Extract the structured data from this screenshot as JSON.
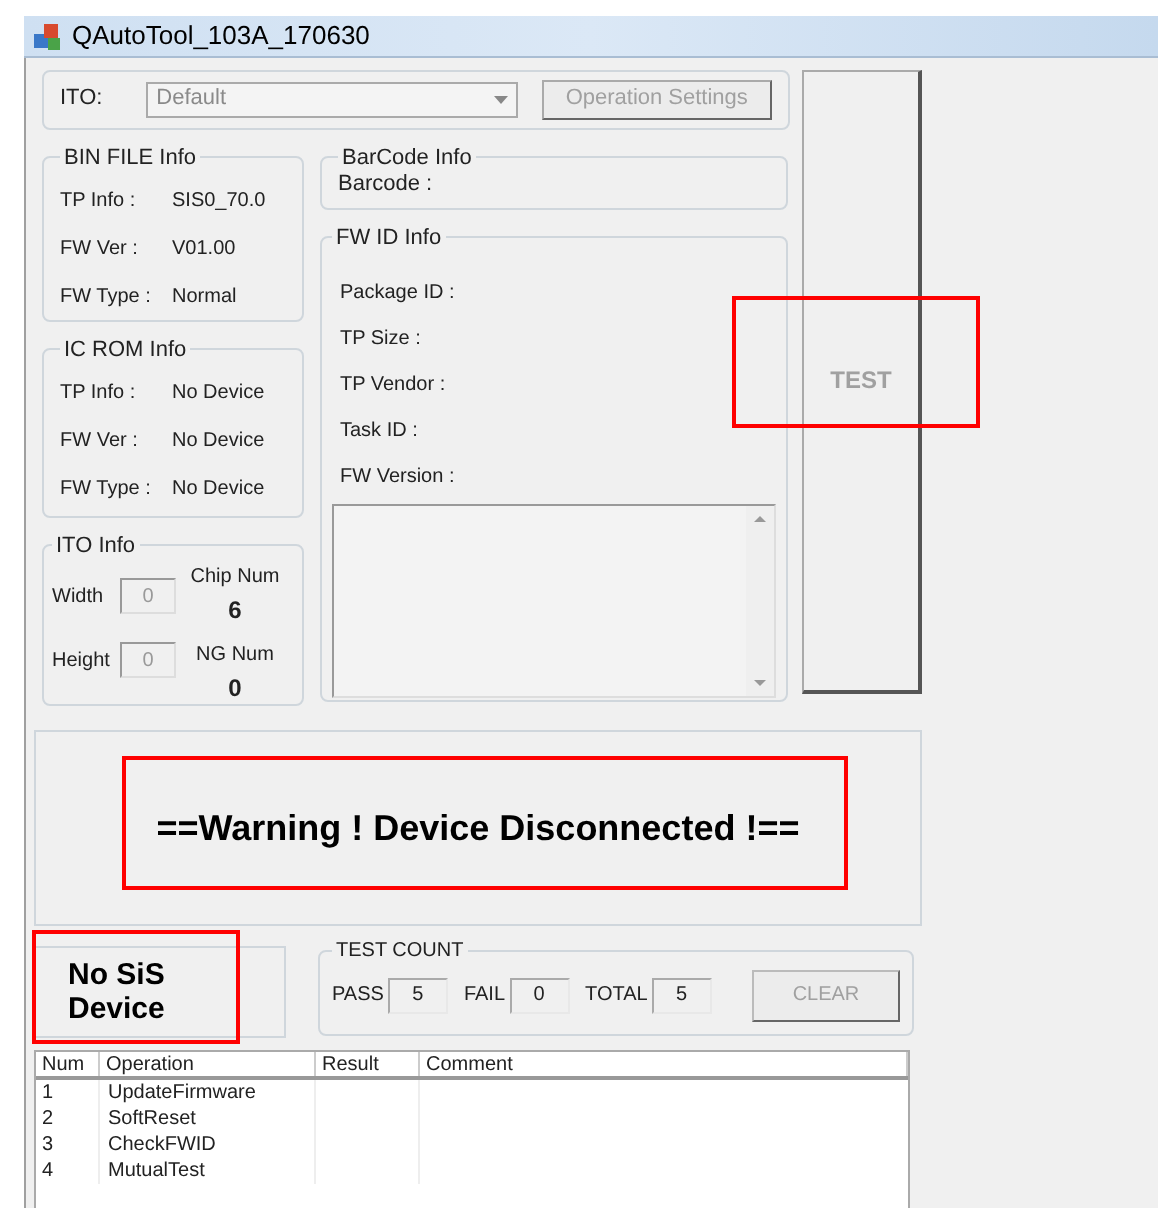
{
  "window": {
    "title": "QAutoTool_103A_170630"
  },
  "ito_bar": {
    "label": "ITO:",
    "combo_value": "Default",
    "combo_disabled": true,
    "button": "Operation Settings",
    "button_disabled": true
  },
  "bin_file_info": {
    "title": "BIN FILE Info",
    "rows": [
      {
        "label": "TP Info :",
        "value": "SIS0_70.0"
      },
      {
        "label": "FW Ver :",
        "value": "V01.00"
      },
      {
        "label": "FW Type :",
        "value": "Normal"
      }
    ]
  },
  "ic_rom_info": {
    "title": "IC ROM Info",
    "rows": [
      {
        "label": "TP Info :",
        "value": "No Device"
      },
      {
        "label": "FW Ver :",
        "value": "No Device"
      },
      {
        "label": "FW Type :",
        "value": "No Device"
      }
    ]
  },
  "ito_info": {
    "title": "ITO Info",
    "width_label": "Width",
    "width_value": "0",
    "height_label": "Height",
    "height_value": "0",
    "chip_num_label": "Chip Num",
    "chip_num": "6",
    "ng_num_label": "NG Num",
    "ng_num": "0"
  },
  "barcode_info": {
    "title": "BarCode Info",
    "label": "Barcode :"
  },
  "fw_id_info": {
    "title": "FW ID Info",
    "labels": [
      "Package ID :",
      "TP Size :",
      "TP Vendor :",
      "Task ID :",
      "FW Version :"
    ]
  },
  "test_button": {
    "label": "TEST",
    "disabled": true,
    "highlighted": true
  },
  "warning": {
    "text": "==Warning ! Device Disconnected !==",
    "highlighted": true
  },
  "device_status": {
    "text": "No SiS Device",
    "highlighted": true
  },
  "test_count": {
    "title": "TEST COUNT",
    "fields": [
      {
        "label": "PASS",
        "value": "5"
      },
      {
        "label": "FAIL",
        "value": "0"
      },
      {
        "label": "TOTAL",
        "value": "5"
      }
    ],
    "clear_button": "CLEAR",
    "clear_disabled": true
  },
  "table": {
    "columns": [
      "Num",
      "Operation",
      "Result",
      "Comment"
    ],
    "rows": [
      {
        "num": "1",
        "operation": "UpdateFirmware"
      },
      {
        "num": "2",
        "operation": "SoftReset"
      },
      {
        "num": "3",
        "operation": "CheckFWID"
      },
      {
        "num": "4",
        "operation": "MutualTest"
      }
    ]
  }
}
